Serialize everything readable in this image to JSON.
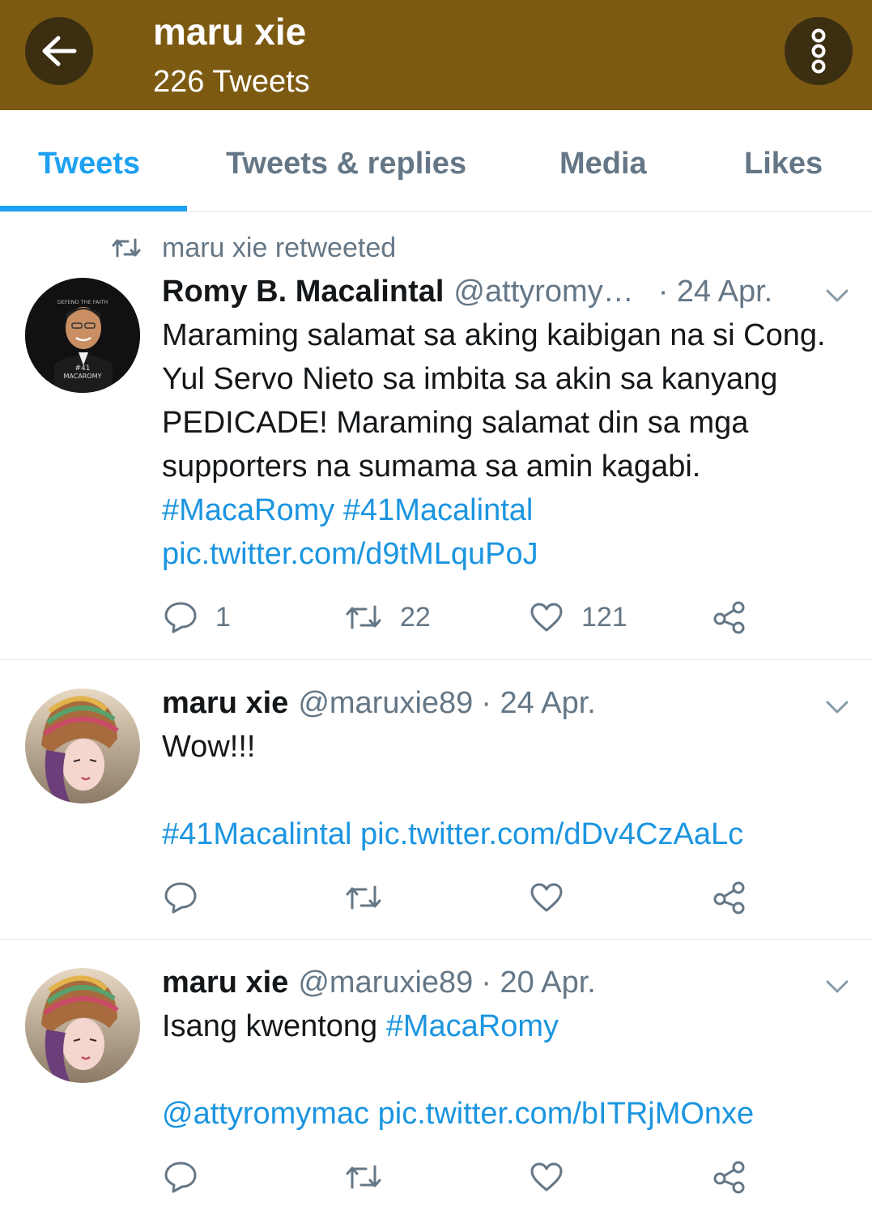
{
  "header": {
    "title": "maru xie",
    "subtitle": "226 Tweets",
    "back_icon": "arrow-left-icon",
    "more_icon": "more-vertical-icon",
    "bg_color": "#7d5a12"
  },
  "tabs": [
    {
      "label": "Tweets",
      "active": true
    },
    {
      "label": "Tweets & replies",
      "active": false
    },
    {
      "label": "Media",
      "active": false
    },
    {
      "label": "Likes",
      "active": false
    }
  ],
  "accent_color": "#1da1f2",
  "tweets": [
    {
      "retweet_label": "maru xie retweeted",
      "name": "Romy B. Macalintal",
      "handle": "@attyromy…",
      "date": "· 24 Apr.",
      "text_plain": "Maramiing salamat sa aking kaibigan na si Cong. Yul Servo Nieto sa imbita sa akin sa kanyang PEDICADE! Maraming salamat din sa mga supporters na sumama sa amin kagabi.",
      "hashtag1": "#MacaRomy",
      "hashtag2": "#41Macalintal",
      "pic_link": "pic.twitter.com/d9tMLquPoJ",
      "reply_count": "1",
      "retweet_count": "22",
      "like_count": "121"
    },
    {
      "name": "maru xie",
      "handle": "@maruxie89",
      "date": "· 24 Apr.",
      "text_plain": "Wow!!!",
      "hashtag1": "#41Macalintal",
      "pic_link": "pic.twitter.com/dDv4CzAaLc"
    },
    {
      "name": "maru xie",
      "handle": "@maruxie89",
      "date": "· 20 Apr.",
      "text_plain": "Isang kwentong",
      "hashtag1": "#MacaRomy",
      "mention": "@attyromymac",
      "pic_link": "pic.twitter.com/bITRjMOnxe"
    }
  ],
  "avatar_labels": {
    "romy_top": "DEFEND THE FAITH",
    "romy_number": "#41",
    "romy_brand": "MACAROMY"
  }
}
